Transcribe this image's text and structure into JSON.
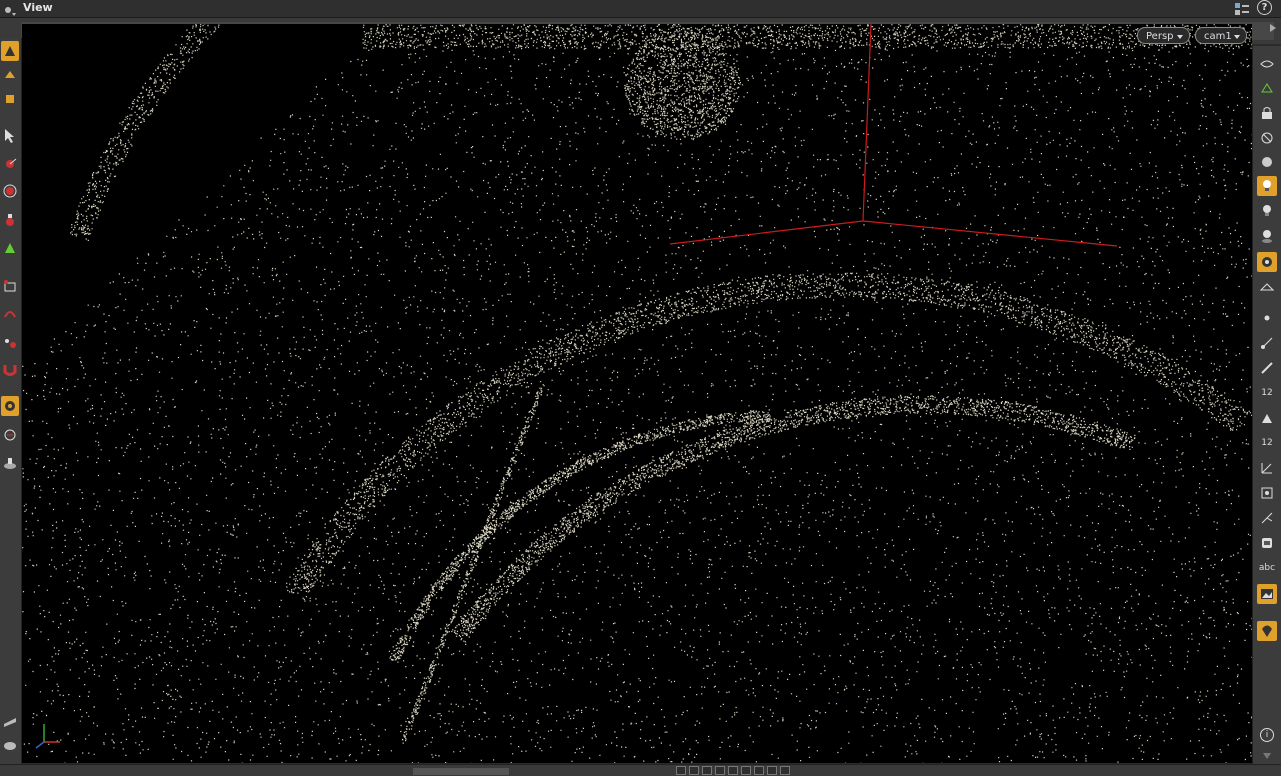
{
  "title_bar": {
    "title": "View",
    "help_label": "?"
  },
  "viewport": {
    "projection_label": "Persp",
    "camera_label": "cam1",
    "background": "#000000",
    "point_color": "#d8d4c0",
    "handle_color": "#cc1b1b"
  },
  "right_toolbar": {
    "number_label_1": "12",
    "number_label_2": "12",
    "text_label": "abc",
    "info_label": "i"
  },
  "accent_color": "#e0a12b"
}
